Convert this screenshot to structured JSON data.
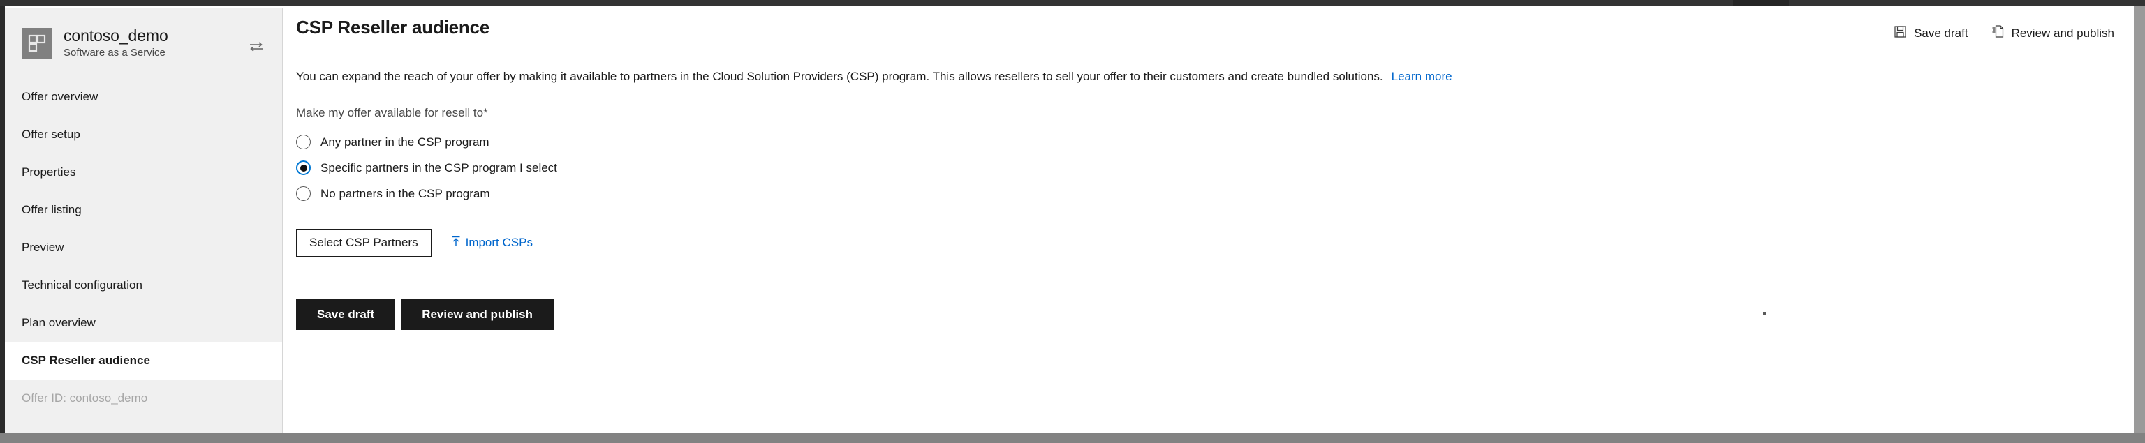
{
  "window": {
    "accent_color": "#0078d4",
    "link_color": "#0066cc",
    "dark_button_color": "#1b1b1b"
  },
  "sidebar": {
    "brand": {
      "title": "contoso_demo",
      "subtitle": "Software as a Service",
      "logo_icon": "app-tile-icon",
      "swap_icon": "swap-arrows-icon"
    },
    "items": [
      {
        "label": "Offer overview",
        "active": false
      },
      {
        "label": "Offer setup",
        "active": false
      },
      {
        "label": "Properties",
        "active": false
      },
      {
        "label": "Offer listing",
        "active": false
      },
      {
        "label": "Preview",
        "active": false
      },
      {
        "label": "Technical configuration",
        "active": false
      },
      {
        "label": "Plan overview",
        "active": false
      },
      {
        "label": "CSP Reseller audience",
        "active": true
      }
    ],
    "offer_id": "Offer ID: contoso_demo"
  },
  "header": {
    "title": "CSP Reseller audience",
    "actions": [
      {
        "label": "Save draft",
        "icon": "save-icon"
      },
      {
        "label": "Review and publish",
        "icon": "publish-document-icon"
      }
    ]
  },
  "main": {
    "description": "You can expand the reach of your offer by making it available to partners in the Cloud Solution Providers (CSP) program. This allows resellers to sell your offer to their customers and create bundled solutions.",
    "learn_more": "Learn more",
    "field_label": "Make my offer available for resell to*",
    "radio_options": [
      {
        "label": "Any partner in the CSP program",
        "checked": false
      },
      {
        "label": "Specific partners in the CSP program I select",
        "checked": true
      },
      {
        "label": "No partners in the CSP program",
        "checked": false
      }
    ],
    "select_partners_button": "Select CSP Partners",
    "import_csps_link": "Import CSPs",
    "import_icon": "upload-icon",
    "footer_buttons": [
      {
        "label": "Save draft"
      },
      {
        "label": "Review and publish"
      }
    ]
  }
}
